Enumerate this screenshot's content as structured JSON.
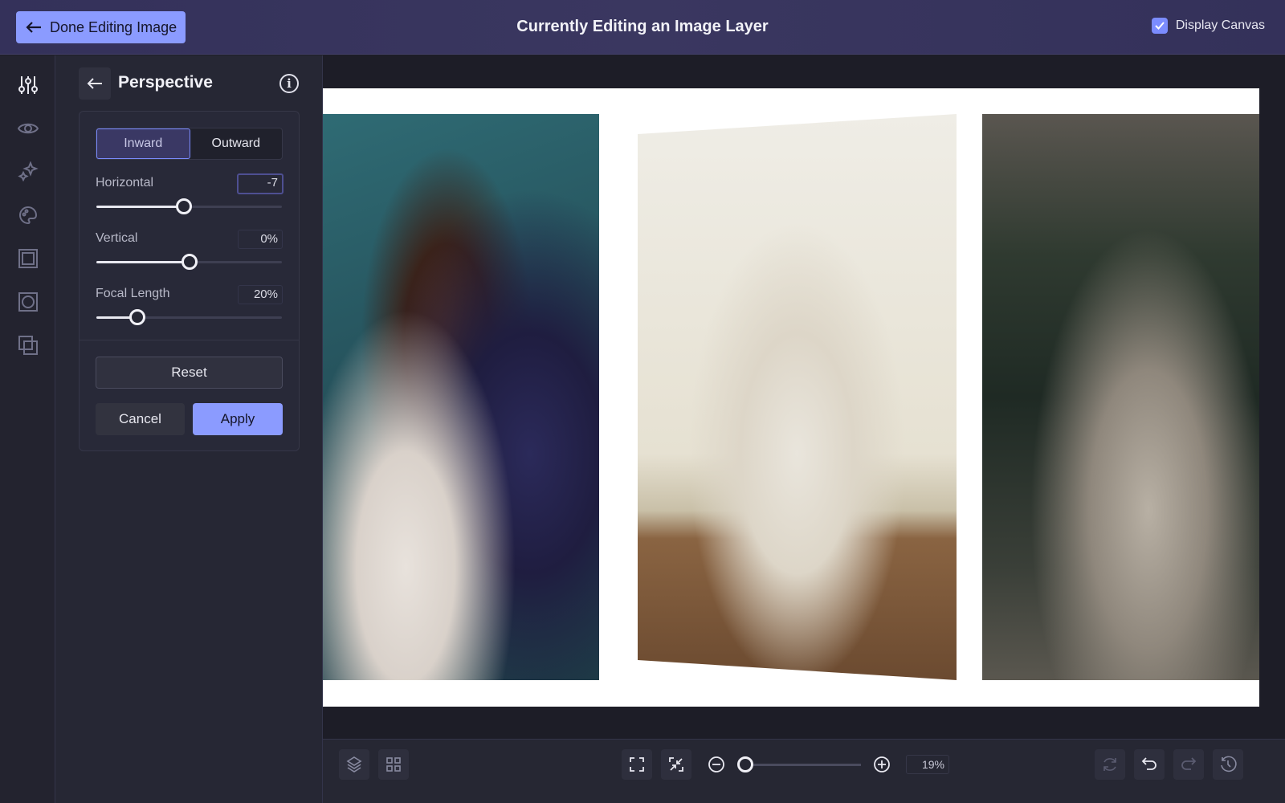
{
  "header": {
    "done_label": "Done Editing Image",
    "title": "Currently Editing an Image Layer",
    "display_canvas_label": "Display Canvas",
    "display_canvas_checked": true
  },
  "rail": {
    "items": [
      "adjustments-icon",
      "eye-icon",
      "sparkles-icon",
      "palette-icon",
      "frame-icon",
      "mask-icon",
      "overlay-icon"
    ]
  },
  "panel": {
    "title": "Perspective",
    "mode_options": [
      "Inward",
      "Outward"
    ],
    "mode_selected": "Inward",
    "horizontal": {
      "label": "Horizontal",
      "value": "-7",
      "fraction": 0.47
    },
    "vertical": {
      "label": "Vertical",
      "value": "0%",
      "fraction": 0.5
    },
    "focal_length": {
      "label": "Focal Length",
      "value": "20%",
      "fraction": 0.22
    },
    "reset_label": "Reset",
    "cancel_label": "Cancel",
    "apply_label": "Apply"
  },
  "bottom": {
    "zoom_value": "19%",
    "zoom_fraction": 0.05
  },
  "colors": {
    "accent": "#8b9bff",
    "header_bg": "#36335c",
    "panel_bg": "#262734"
  }
}
